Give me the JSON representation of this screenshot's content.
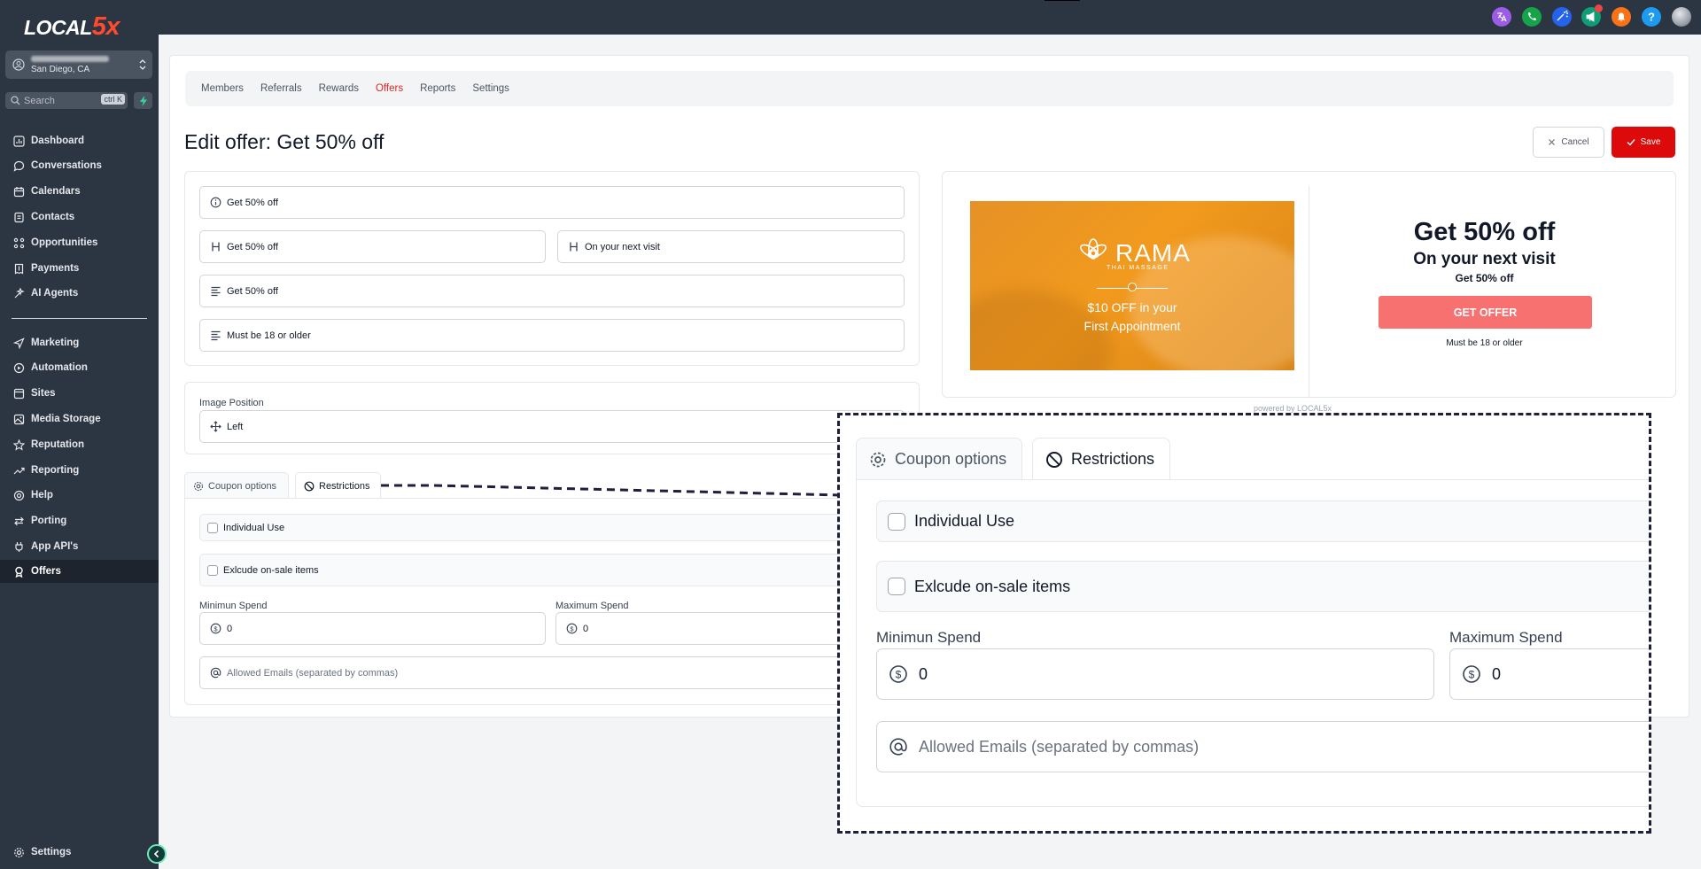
{
  "brand": {
    "logo_text": "LOCAL",
    "logo_num": "5x"
  },
  "location": {
    "city": "San Diego, CA"
  },
  "search": {
    "placeholder": "Search",
    "shortcut": "ctrl K"
  },
  "nav": {
    "dashboard": "Dashboard",
    "conversations": "Conversations",
    "calendars": "Calendars",
    "contacts": "Contacts",
    "opportunities": "Opportunities",
    "payments": "Payments",
    "ai_agents": "AI Agents",
    "marketing": "Marketing",
    "automation": "Automation",
    "sites": "Sites",
    "media_storage": "Media Storage",
    "reputation": "Reputation",
    "reporting": "Reporting",
    "help": "Help",
    "porting": "Porting",
    "app_apis": "App API's",
    "offers": "Offers",
    "settings": "Settings"
  },
  "topbar": {
    "icons": [
      "translate-icon",
      "phone-icon",
      "magic-icon",
      "megaphone-icon",
      "bell-icon",
      "help-icon",
      "avatar"
    ],
    "colors": [
      "#9b5de5",
      "#16a34a",
      "#2563eb",
      "#0f9d75",
      "#f97316",
      "#1d9bf0",
      "#9ca3af"
    ]
  },
  "subnav": {
    "members": "Members",
    "referrals": "Referrals",
    "rewards": "Rewards",
    "offers": "Offers",
    "reports": "Reports",
    "settings": "Settings"
  },
  "page": {
    "title": "Edit offer: Get 50% off",
    "cancel": "Cancel",
    "save": "Save"
  },
  "form": {
    "name": "Get 50% off",
    "heading": "Get 50% off",
    "subheading": "On your next visit",
    "description": "Get 50% off",
    "terms": "Must be 18 or older",
    "image_position_label": "Image Position",
    "image_position": "Left"
  },
  "tabs": {
    "coupon_options": "Coupon options",
    "restrictions": "Restrictions"
  },
  "restrictions": {
    "individual_use": "Individual Use",
    "exclude_sale": "Exlcude on-sale items",
    "min_spend_label": "Minimun Spend",
    "min_spend": "0",
    "max_spend_label": "Maximum Spend",
    "max_spend": "0",
    "emails_placeholder": "Allowed Emails (separated by commas)"
  },
  "preview": {
    "brand_name": "RAMA",
    "brand_sub": "THAI MASSAGE",
    "image_line1": "$10 OFF in your",
    "image_line2": "First Appointment",
    "title": "Get 50% off",
    "subtitle": "On your next visit",
    "description": "Get 50% off",
    "button": "GET OFFER",
    "terms": "Must be 18 or older",
    "powered": "powered by LOCAL5x"
  },
  "colors": {
    "accent": "#dc2626",
    "sidebar": "#2c3542",
    "offer_button": "#f87171",
    "save": "#dc0a0a"
  }
}
